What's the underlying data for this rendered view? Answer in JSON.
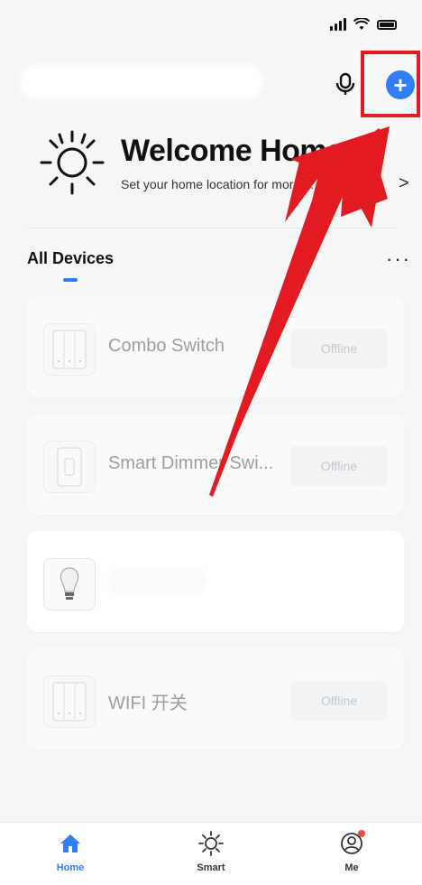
{
  "header": {
    "welcome_title": "Welcome Home",
    "welcome_subtitle": "Set your home location for more i...",
    "welcome_chevron": ">"
  },
  "tabs": {
    "all_devices": "All Devices",
    "more": "···"
  },
  "devices": [
    {
      "name": "Combo Switch",
      "status": "Offline",
      "icon": "triple-switch-icon"
    },
    {
      "name": "Smart Dimmer Swi...",
      "status": "Offline",
      "icon": "dimmer-switch-icon"
    },
    {
      "name": "",
      "status": "",
      "icon": "light-bulb-icon"
    },
    {
      "name": "WIFI 开关",
      "status": "Offline",
      "icon": "triple-switch-icon"
    }
  ],
  "bottom_nav": [
    {
      "label": "Home",
      "icon": "home-icon",
      "active": true
    },
    {
      "label": "Smart",
      "icon": "sun-icon",
      "active": false
    },
    {
      "label": "Me",
      "icon": "user-icon",
      "active": false
    }
  ],
  "colors": {
    "accent": "#2f7ef5",
    "annotation": "#e21b22",
    "badge_bg": "#eef1f4"
  }
}
